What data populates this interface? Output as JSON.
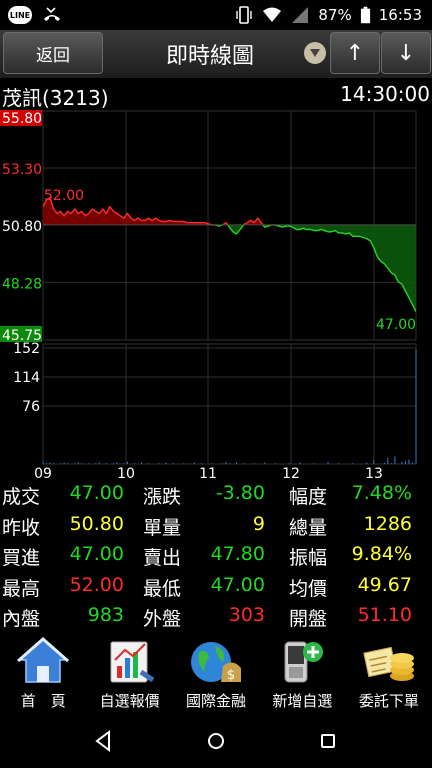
{
  "status_bar": {
    "battery": "87%",
    "time": "16:53",
    "line_badge": "LINE"
  },
  "titlebar": {
    "back_label": "返回",
    "title": "即時線圖",
    "up_label": "↑",
    "down_label": "↓"
  },
  "stock": {
    "name": "茂訊(3213)",
    "time": "14:30:00"
  },
  "chart_data": {
    "type": "line",
    "y_price_labels": [
      "55.80",
      "53.30",
      "50.80",
      "48.28",
      "45.75"
    ],
    "ref_price": 50.8,
    "ylim_price": [
      45.75,
      55.8
    ],
    "high_label": "52.00",
    "low_label": "47.00",
    "y_volume_labels": [
      "152",
      "114",
      "76"
    ],
    "ylim_volume": [
      0,
      152
    ],
    "x_labels": [
      "09",
      "10",
      "11",
      "12",
      "13"
    ],
    "series": [
      {
        "values": [
          51.6,
          51.9,
          52.0,
          51.5,
          51.3,
          51.4,
          51.2,
          51.4,
          51.3,
          51.5,
          51.3,
          51.4,
          51.2,
          51.3,
          51.5,
          51.4,
          51.3,
          51.5,
          51.3,
          51.6,
          51.4,
          51.3,
          51.2,
          51.1,
          51.3,
          51.1,
          51.0,
          51.1,
          51.0,
          51.0,
          51.1,
          51.0,
          51.1,
          51.0,
          50.95,
          50.95,
          51.0,
          50.95,
          50.95,
          50.95,
          50.95,
          50.9,
          50.9,
          50.9,
          50.9,
          50.9,
          50.9,
          50.85,
          50.8,
          50.8,
          50.75,
          50.8,
          50.9,
          50.7,
          50.5,
          50.4,
          50.6,
          50.8,
          50.9,
          51.0,
          50.9,
          51.1,
          50.9,
          50.7,
          50.75,
          50.8,
          50.8,
          50.75,
          50.7,
          50.75,
          50.75,
          50.7,
          50.6,
          50.6,
          50.65,
          50.6,
          50.6,
          50.55,
          50.55,
          50.6,
          50.55,
          50.5,
          50.5,
          50.55,
          50.45,
          50.45,
          50.4,
          50.45,
          50.3,
          50.3,
          50.3,
          50.25,
          50.2,
          50.1,
          49.8,
          49.4,
          49.2,
          49.1,
          48.9,
          48.7,
          48.6,
          48.3,
          48.2,
          47.9,
          47.6,
          47.3,
          47.0
        ]
      }
    ],
    "volume": [
      3,
      1,
      2,
      1,
      0,
      1,
      2,
      1,
      0,
      1,
      2,
      1,
      0,
      1,
      0,
      1,
      2,
      0,
      1,
      0,
      1,
      2,
      0,
      1,
      3,
      0,
      1,
      0,
      2,
      0,
      1,
      0,
      0,
      1,
      0,
      2,
      0,
      1,
      0,
      0,
      1,
      0,
      0,
      2,
      0,
      1,
      0,
      0,
      1,
      0,
      0,
      1,
      3,
      1,
      0,
      2,
      0,
      1,
      0,
      0,
      1,
      0,
      0,
      2,
      0,
      0,
      1,
      0,
      0,
      0,
      1,
      0,
      0,
      2,
      0,
      0,
      0,
      1,
      0,
      0,
      0,
      3,
      0,
      0,
      1,
      0,
      0,
      0,
      1,
      0,
      0,
      0,
      2,
      0,
      5,
      0,
      0,
      2,
      8,
      1,
      10,
      0,
      3,
      4,
      6,
      2,
      150
    ]
  },
  "quote": [
    [
      {
        "label": "成交",
        "value": "47.00",
        "color": "green"
      },
      {
        "label": "漲跌",
        "value": "-3.80",
        "color": "green"
      },
      {
        "label": "幅度",
        "value": "7.48%",
        "color": "green"
      }
    ],
    [
      {
        "label": "昨收",
        "value": "50.80",
        "color": "yellow"
      },
      {
        "label": "單量",
        "value": "9",
        "color": "yellow"
      },
      {
        "label": "總量",
        "value": "1286",
        "color": "yellow"
      }
    ],
    [
      {
        "label": "買進",
        "value": "47.00",
        "color": "green"
      },
      {
        "label": "賣出",
        "value": "47.80",
        "color": "green"
      },
      {
        "label": "振幅",
        "value": "9.84%",
        "color": "yellow"
      }
    ],
    [
      {
        "label": "最高",
        "value": "52.00",
        "color": "red"
      },
      {
        "label": "最低",
        "value": "47.00",
        "color": "green"
      },
      {
        "label": "均價",
        "value": "49.67",
        "color": "yellow"
      }
    ],
    [
      {
        "label": "內盤",
        "value": "983",
        "color": "green"
      },
      {
        "label": "外盤",
        "value": "303",
        "color": "red"
      },
      {
        "label": "開盤",
        "value": "51.10",
        "color": "red"
      }
    ]
  ],
  "bottom_nav": [
    {
      "label": "首　頁",
      "icon": "home-icon"
    },
    {
      "label": "自選報價",
      "icon": "watchlist-chart-icon"
    },
    {
      "label": "國際金融",
      "icon": "globe-money-icon"
    },
    {
      "label": "新增自選",
      "icon": "phone-add-icon"
    },
    {
      "label": "委託下單",
      "icon": "coins-order-icon"
    }
  ],
  "colors": {
    "up": "#ff2b2b",
    "down": "#22d822",
    "flat": "#ffff33",
    "grid": "#2f2f2f"
  }
}
